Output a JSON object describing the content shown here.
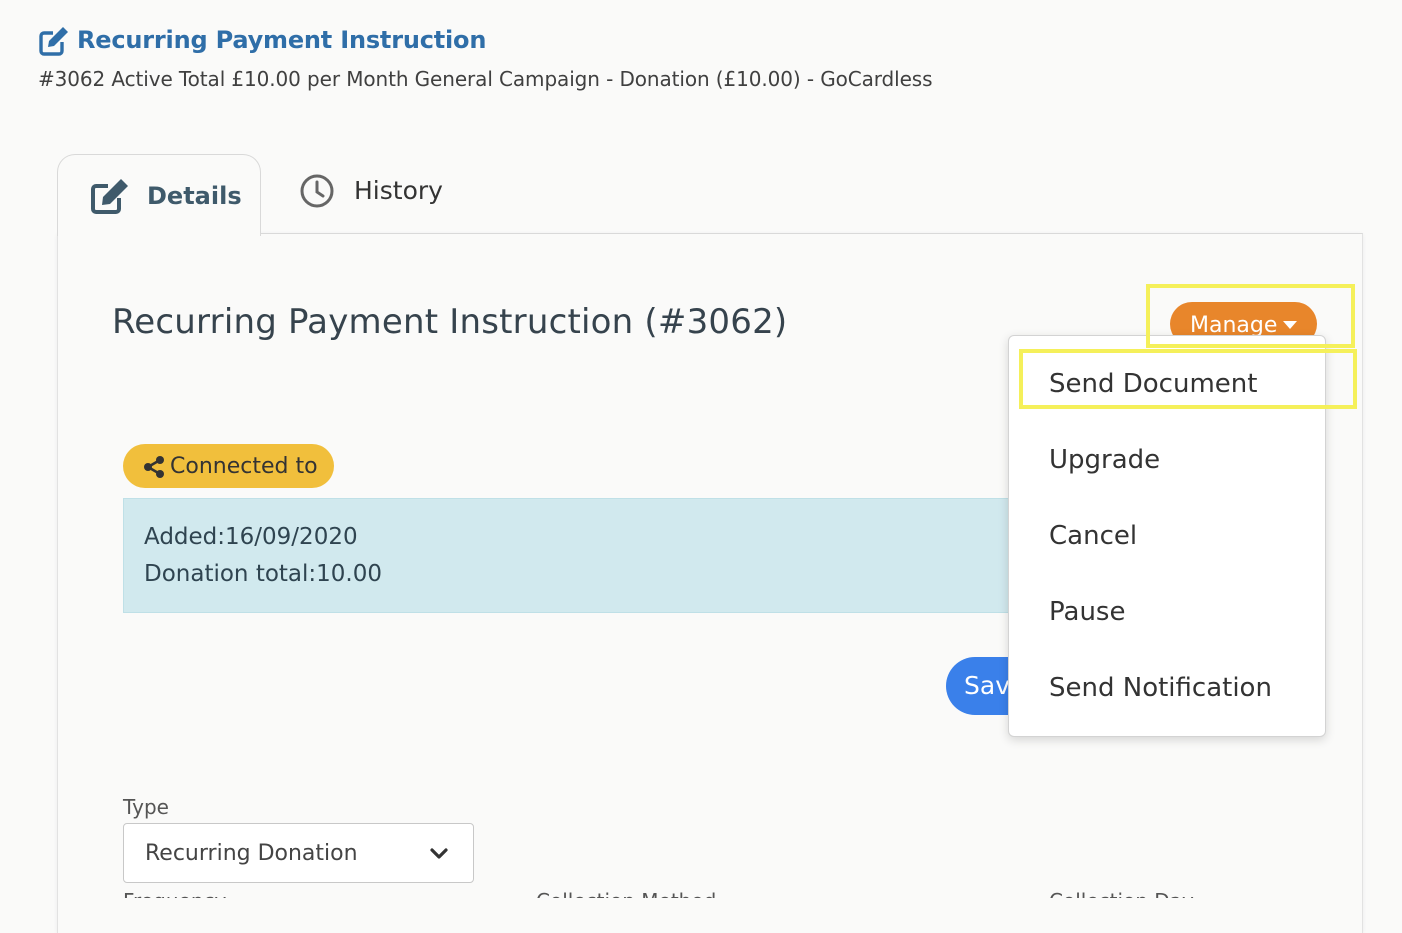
{
  "header": {
    "title": "Recurring Payment Instruction",
    "subtitle": "#3062 Active Total £10.00 per Month General Campaign - Donation (£10.00) - GoCardless",
    "title_icon": "edit-icon"
  },
  "tabs": [
    {
      "label": "Details",
      "icon": "edit-icon",
      "active": true
    },
    {
      "label": "History",
      "icon": "clock-icon",
      "active": false
    }
  ],
  "panel": {
    "title": "Recurring Payment Instruction (#3062)",
    "manage_label": "Manage",
    "connected_label": "Connected to",
    "info": {
      "added": "Added:16/09/2020",
      "total": "Donation total:10.00"
    },
    "save_label": "Save",
    "type_label": "Type",
    "type_value": "Recurring Donation",
    "partial_labels": [
      "Frequency",
      "Collection Method",
      "Collection Day"
    ]
  },
  "manage_menu": [
    "Send Document",
    "Upgrade",
    "Cancel",
    "Pause",
    "Send Notification"
  ],
  "colors": {
    "title_blue": "#2f6ea8",
    "manage_orange": "#e8862b",
    "badge_yellow": "#f1bf3c",
    "info_bg": "#d1e9ee",
    "save_blue": "#3a80ea",
    "highlight": "#f5f05a"
  }
}
